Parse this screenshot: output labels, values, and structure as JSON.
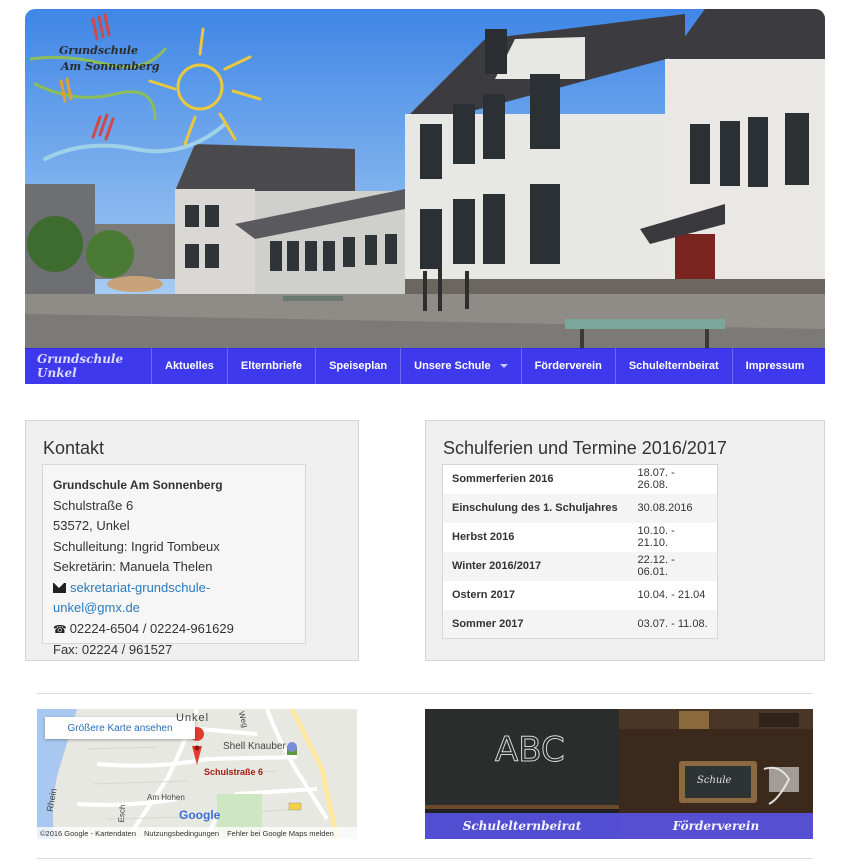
{
  "header": {
    "logo_line1": "Grundschule",
    "logo_line2": "Am Sonnenberg"
  },
  "nav": {
    "brand": "Grundschule Unkel",
    "items": [
      "Aktuelles",
      "Elternbriefe",
      "Speiseplan",
      "Unsere Schule",
      "Förderverein",
      "Schulelternbeirat",
      "Impressum"
    ]
  },
  "contact": {
    "heading": "Kontakt",
    "name": "Grundschule Am Sonnenberg",
    "street": "Schulstraße 6",
    "city": "53572, Unkel",
    "head": "Schulleitung: Ingrid Tombeux",
    "secretary": "Sekretärin: Manuela Thelen",
    "email": "sekretariat-grundschule-unkel@gmx.de",
    "phone": "02224-6504 / 02224-961629",
    "fax": "Fax: 02224 / 961527"
  },
  "dates": {
    "heading": "Schulferien und Termine 2016/2017",
    "rows": [
      {
        "event": "Sommerferien 2016",
        "date": "18.07. - 26.08."
      },
      {
        "event": "Einschulung des 1. Schuljahres",
        "date": "30.08.2016"
      },
      {
        "event": "Herbst 2016",
        "date": "10.10. - 21.10."
      },
      {
        "event": "Winter 2016/2017",
        "date": "22.12. - 06.01."
      },
      {
        "event": "Ostern 2017",
        "date": "10.04. - 21.04"
      },
      {
        "event": "Sommer 2017",
        "date": "03.07. - 11.08."
      }
    ]
  },
  "map": {
    "button": "Größere Karte ansehen",
    "town": "Unkel",
    "poi": "Shell Knauber",
    "marker": "Schulstraße 6",
    "street1": "Am Hohen",
    "street2": "Weg",
    "river": "Rhein",
    "street3": "Esch",
    "google": "Google",
    "footer": [
      "©2016 Google - Kartendaten",
      "Nutzungsbedingungen",
      "Fehler bei Google Maps melden"
    ]
  },
  "tiles": [
    {
      "caption": "Schulelternbeirat",
      "chalk": "ABC"
    },
    {
      "caption": "Förderverein",
      "slate": "Schule"
    }
  ],
  "colors": {
    "nav_bg": "#2a24eb",
    "link": "#2a7bbf"
  }
}
